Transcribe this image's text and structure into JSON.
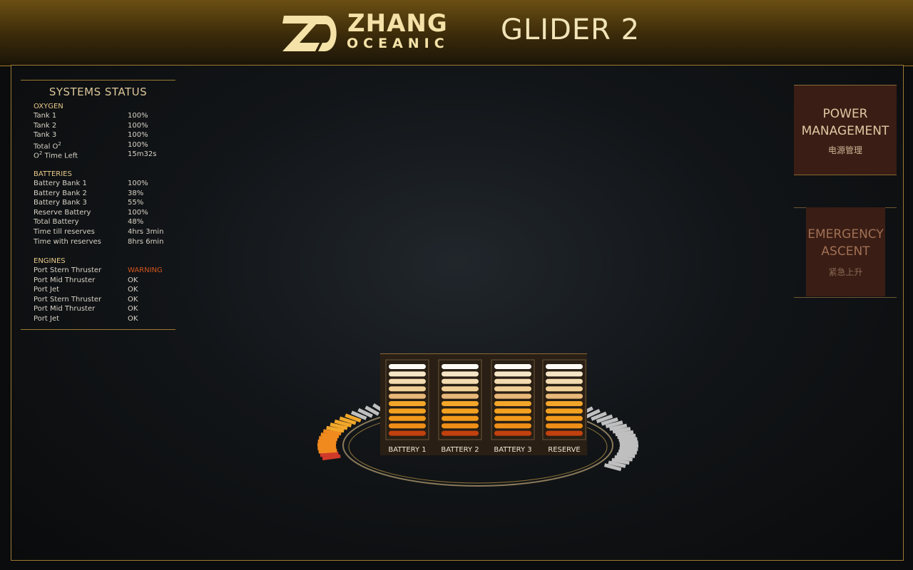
{
  "header": {
    "brand_name": "ZHANG",
    "brand_sub": "OCEANIC",
    "product": "GLIDER 2"
  },
  "status": {
    "title": "SYSTEMS STATUS",
    "sections": [
      {
        "name": "OXYGEN",
        "rows": [
          {
            "label": "Tank 1",
            "value": "100%"
          },
          {
            "label": "Tank 2",
            "value": "100%"
          },
          {
            "label": "Tank 3",
            "value": "100%"
          },
          {
            "label": "Total O",
            "sup": "2",
            "value": "100%"
          },
          {
            "label": "O",
            "sup": "2",
            "label_tail": " Time Left",
            "value": "15m32s"
          }
        ]
      },
      {
        "name": "BATTERIES",
        "rows": [
          {
            "label": "Battery Bank 1",
            "value": "100%"
          },
          {
            "label": "Battery Bank 2",
            "value": "38%"
          },
          {
            "label": "Battery Bank 3",
            "value": "55%"
          },
          {
            "label": "Reserve Battery",
            "value": "100%"
          },
          {
            "label": "Total Battery",
            "value": "48%"
          },
          {
            "label": "Time till reserves",
            "value": "4hrs 3min"
          },
          {
            "label": "Time with reserves",
            "value": "8hrs 6min"
          }
        ]
      },
      {
        "name": "ENGINES",
        "rows": [
          {
            "label": "Port Stern Thruster",
            "value": "WARNING",
            "warn": true
          },
          {
            "label": "Port Mid Thruster",
            "value": "OK"
          },
          {
            "label": "Port Jet",
            "value": "OK"
          },
          {
            "label": "Port Stern Thruster",
            "value": "OK"
          },
          {
            "label": "Port Mid Thruster",
            "value": "OK"
          },
          {
            "label": "Port Jet",
            "value": "OK"
          }
        ]
      }
    ]
  },
  "buttons": {
    "power_line1": "POWER",
    "power_line2": "MANAGEMENT",
    "power_cn": "电源管理",
    "emergency_line1": "EMERGENCY",
    "emergency_line2": "ASCENT",
    "emergency_cn": "紧急上升"
  },
  "batteries": [
    {
      "label": "BATTERY 1"
    },
    {
      "label": "BATTERY 2"
    },
    {
      "label": "BATTERY 3"
    },
    {
      "label": "RESERVE"
    }
  ],
  "colors": {
    "accent": "#c9a24a",
    "warning": "#d0541e",
    "panel": "#3a1d14"
  }
}
